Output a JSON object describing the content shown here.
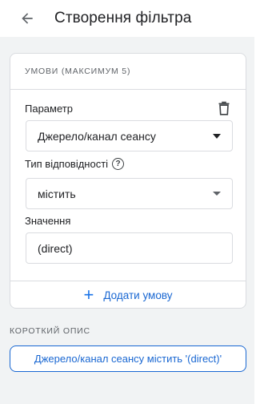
{
  "header": {
    "title": "Створення фільтра",
    "back_icon": "arrow-back-icon"
  },
  "conditions": {
    "section_label": "УМОВИ (МАКСИМУМ 5)",
    "parameter": {
      "label": "Параметр",
      "value": "Джерело/канал сеансу",
      "delete_icon": "trash-icon"
    },
    "match_type": {
      "label": "Тип відповідності",
      "help_icon": "help-circle-icon",
      "value": "містить"
    },
    "value_field": {
      "label": "Значення",
      "value": "(direct)"
    },
    "add_condition": {
      "icon": "plus-icon",
      "label": "Додати умову"
    }
  },
  "summary": {
    "section_label": "КОРОТКИЙ ОПИС",
    "text": "Джерело/канал сеансу містить '(direct)'"
  },
  "colors": {
    "accent": "#1967d2",
    "background": "#f1f3f4",
    "border": "#dadce0"
  }
}
